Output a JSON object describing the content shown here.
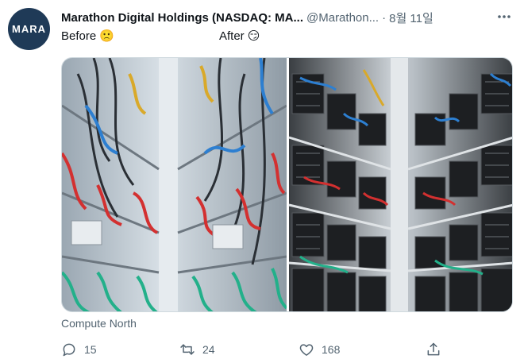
{
  "tweet": {
    "avatar_text": "MARA",
    "author_name": "Marathon Digital Holdings (NASDAQ: MA...",
    "handle": "@Marathon...",
    "separator": "·",
    "date": "8월 11일",
    "text": {
      "before_label": "Before",
      "before_emoji": "🙁",
      "after_label": "After",
      "after_emoji": "😏"
    },
    "media_credit": "Compute North",
    "actions": {
      "reply_count": "15",
      "retweet_count": "24",
      "like_count": "168"
    }
  },
  "icons": {
    "more": "more-horizontal-icon",
    "reply": "reply-icon",
    "retweet": "retweet-icon",
    "like": "heart-icon",
    "share": "share-icon"
  },
  "colors": {
    "text_primary": "#0f1419",
    "text_secondary": "#536471",
    "avatar_bg": "#1f3a57",
    "emoji_yellow": "#f7c536"
  }
}
